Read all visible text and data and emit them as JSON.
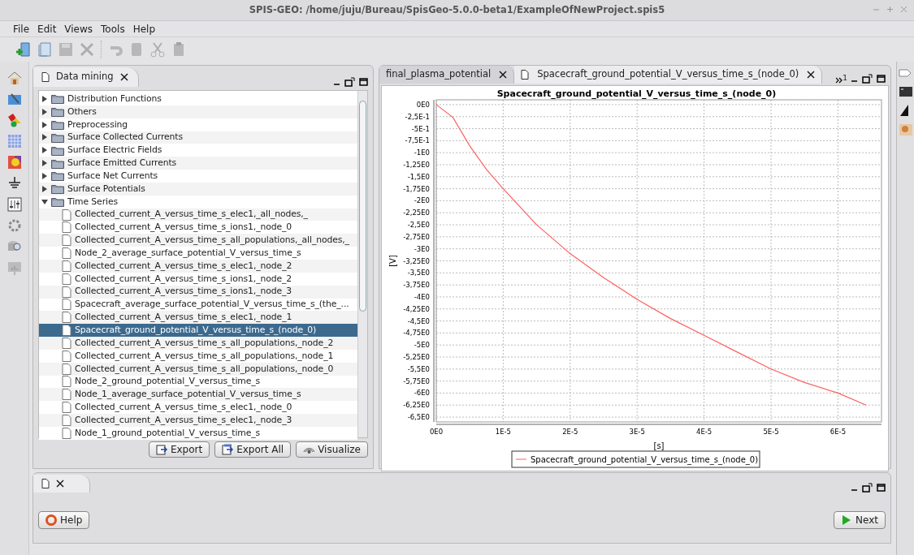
{
  "window": {
    "title": "SPIS-GEO: /home/juju/Bureau/SpisGeo-5.0.0-beta1/ExampleOfNewProject.spis5"
  },
  "menu": [
    "File",
    "Edit",
    "Views",
    "Tools",
    "Help"
  ],
  "toolbar": [
    {
      "kind": "new",
      "disabled": false
    },
    {
      "kind": "open",
      "disabled": false
    },
    {
      "kind": "save",
      "disabled": true
    },
    {
      "kind": "tools",
      "disabled": true
    },
    {
      "kind": "sep"
    },
    {
      "kind": "undo",
      "disabled": true
    },
    {
      "kind": "copy",
      "disabled": true
    },
    {
      "kind": "cut",
      "disabled": true
    },
    {
      "kind": "paste",
      "disabled": true
    }
  ],
  "data_panel": {
    "tab": {
      "label": "Data mining",
      "selected": true
    },
    "tree": [
      {
        "label": "Distribution Functions",
        "expanded": false,
        "selected": false
      },
      {
        "label": "Others",
        "expanded": false,
        "selected": false
      },
      {
        "label": "Preprocessing",
        "expanded": false,
        "selected": false
      },
      {
        "label": "Surface Collected Currents",
        "expanded": false,
        "selected": false
      },
      {
        "label": "Surface Electric Fields",
        "expanded": false,
        "selected": false
      },
      {
        "label": "Surface Emitted Currents",
        "expanded": false,
        "selected": false
      },
      {
        "label": "Surface Net Currents",
        "expanded": false,
        "selected": false
      },
      {
        "label": "Surface Potentials",
        "expanded": false,
        "selected": false
      },
      {
        "label": "Time Series",
        "expanded": true,
        "selected": false,
        "children": [
          {
            "label": "Collected_current_A_versus_time_s_elec1,_all_nodes,_",
            "selected": false
          },
          {
            "label": "Collected_current_A_versus_time_s_ions1,_node_0",
            "selected": false
          },
          {
            "label": "Collected_current_A_versus_time_s_all_populations,_all_nodes,_",
            "selected": false
          },
          {
            "label": "Node_2_average_surface_potential_V_versus_time_s",
            "selected": false
          },
          {
            "label": "Collected_current_A_versus_time_s_elec1,_node_2",
            "selected": false
          },
          {
            "label": "Collected_current_A_versus_time_s_ions1,_node_2",
            "selected": false
          },
          {
            "label": "Collected_current_A_versus_time_s_ions1,_node_3",
            "selected": false
          },
          {
            "label": "Spacecraft_average_surface_potential_V_versus_time_s_(the_...",
            "selected": false
          },
          {
            "label": "Collected_current_A_versus_time_s_elec1,_node_1",
            "selected": false
          },
          {
            "label": "Spacecraft_ground_potential_V_versus_time_s_(node_0)",
            "selected": true
          },
          {
            "label": "Collected_current_A_versus_time_s_all_populations,_node_2",
            "selected": false
          },
          {
            "label": "Collected_current_A_versus_time_s_all_populations,_node_1",
            "selected": false
          },
          {
            "label": "Collected_current_A_versus_time_s_all_populations,_node_0",
            "selected": false
          },
          {
            "label": "Node_2_ground_potential_V_versus_time_s",
            "selected": false
          },
          {
            "label": "Node_1_average_surface_potential_V_versus_time_s",
            "selected": false
          },
          {
            "label": "Collected_current_A_versus_time_s_elec1,_node_0",
            "selected": false
          },
          {
            "label": "Collected_current_A_versus_time_s_elec1,_node_3",
            "selected": false
          },
          {
            "label": "Node_1_ground_potential_V_versus_time_s",
            "selected": false
          }
        ]
      }
    ],
    "buttons": [
      {
        "kind": "export",
        "label": "Export"
      },
      {
        "kind": "export_all",
        "label": "Export All"
      },
      {
        "kind": "visualize",
        "label": "Visualize"
      }
    ]
  },
  "chart_panel": {
    "tabs": [
      {
        "label": "final_plasma_potential",
        "selected": false
      },
      {
        "label": "Spacecraft_ground_potential_V_versus_time_s_(node_0)",
        "selected": true
      }
    ],
    "overflow_count": "1",
    "chart_data": {
      "type": "line",
      "grid": true,
      "title": "Spacecraft_ground_potential_V_versus_time_s_(node_0)",
      "xlabel": "[s]",
      "ylabel": "[V]",
      "xlim": [
        0,
        6.65e-05
      ],
      "ylim": [
        -6.6,
        0.1
      ],
      "xticks": [
        {
          "value": 0,
          "label": "0E0"
        },
        {
          "value": 1e-05,
          "label": "1E-5"
        },
        {
          "value": 2e-05,
          "label": "2E-5"
        },
        {
          "value": 3e-05,
          "label": "3E-5"
        },
        {
          "value": 4e-05,
          "label": "4E-5"
        },
        {
          "value": 5e-05,
          "label": "5E-5"
        },
        {
          "value": 6e-05,
          "label": "6E-5"
        }
      ],
      "yticks": [
        {
          "value": 0,
          "label": "0E0"
        },
        {
          "value": -0.25,
          "label": "-2,5E-1"
        },
        {
          "value": -0.5,
          "label": "-5E-1"
        },
        {
          "value": -0.75,
          "label": "-7,5E-1"
        },
        {
          "value": -1,
          "label": "-1E0"
        },
        {
          "value": -1.25,
          "label": "-1,25E0"
        },
        {
          "value": -1.5,
          "label": "-1,5E0"
        },
        {
          "value": -1.75,
          "label": "-1,75E0"
        },
        {
          "value": -2,
          "label": "-2E0"
        },
        {
          "value": -2.25,
          "label": "-2,25E0"
        },
        {
          "value": -2.5,
          "label": "-2,5E0"
        },
        {
          "value": -2.75,
          "label": "-2,75E0"
        },
        {
          "value": -3,
          "label": "-3E0"
        },
        {
          "value": -3.25,
          "label": "-3,25E0"
        },
        {
          "value": -3.5,
          "label": "-3,5E0"
        },
        {
          "value": -3.75,
          "label": "-3,75E0"
        },
        {
          "value": -4,
          "label": "-4E0"
        },
        {
          "value": -4.25,
          "label": "-4,25E0"
        },
        {
          "value": -4.5,
          "label": "-4,5E0"
        },
        {
          "value": -4.75,
          "label": "-4,75E0"
        },
        {
          "value": -5,
          "label": "-5E0"
        },
        {
          "value": -5.25,
          "label": "-5,25E0"
        },
        {
          "value": -5.5,
          "label": "-5,5E0"
        },
        {
          "value": -5.75,
          "label": "-5,75E0"
        },
        {
          "value": -6,
          "label": "-6E0"
        },
        {
          "value": -6.25,
          "label": "-6,25E0"
        },
        {
          "value": -6.5,
          "label": "-6,5E0"
        }
      ],
      "x": [
        0,
        2.5e-06,
        5e-06,
        7.5e-06,
        1e-05,
        1.5e-05,
        2e-05,
        2.5e-05,
        3e-05,
        3.5e-05,
        4e-05,
        4.5e-05,
        5e-05,
        5.5e-05,
        6e-05,
        6.42e-05
      ],
      "series": [
        {
          "name": "Spacecraft_ground_potential_V_versus_time_s_(node_0)",
          "color": "#ff6060",
          "values": [
            0,
            -0.27,
            -0.86,
            -1.35,
            -1.75,
            -2.5,
            -3.1,
            -3.6,
            -4.05,
            -4.45,
            -4.8,
            -5.15,
            -5.5,
            -5.78,
            -6.0,
            -6.25
          ]
        }
      ]
    }
  },
  "bottom_panel": {
    "buttons": [
      {
        "kind": "help",
        "label": "Help"
      },
      {
        "kind": "next",
        "label": "Next"
      }
    ]
  }
}
